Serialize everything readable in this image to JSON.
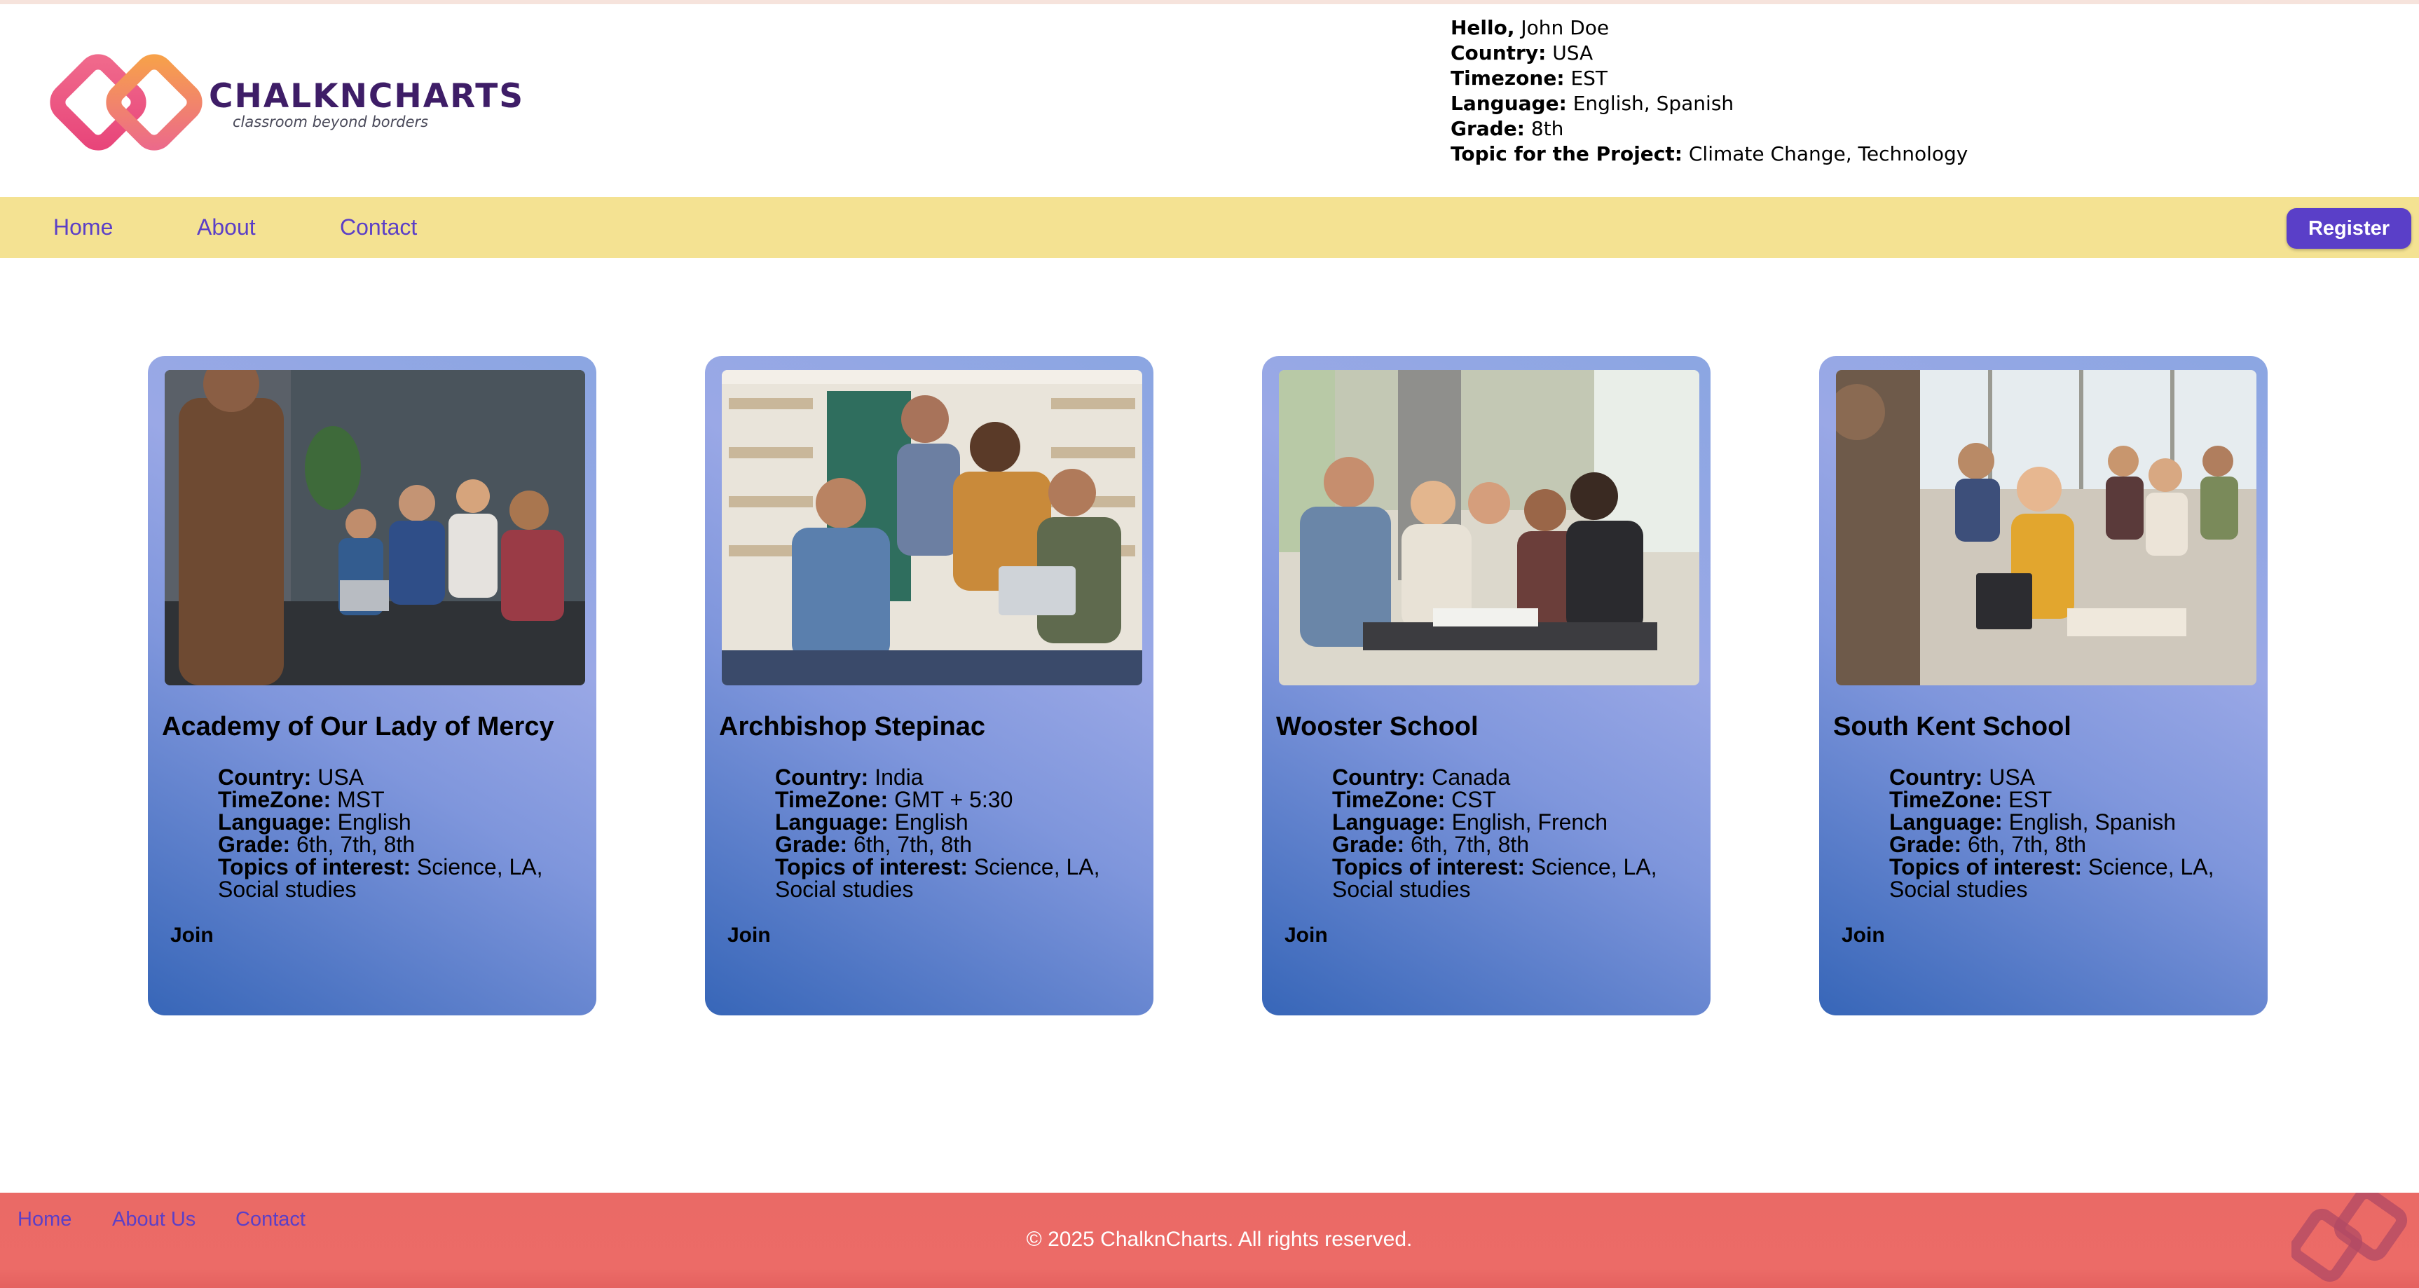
{
  "brand": {
    "name": "CHALKNCHARTS",
    "tagline": "classroom beyond borders"
  },
  "user": {
    "hello_label": "Hello,",
    "name": "John Doe",
    "country_label": "Country:",
    "country": "USA",
    "timezone_label": "Timezone:",
    "timezone": "EST",
    "language_label": "Language:",
    "language": "English, Spanish",
    "grade_label": "Grade:",
    "grade": "8th",
    "topic_label": "Topic for the Project:",
    "topic": "Climate Change, Technology"
  },
  "nav": {
    "items": [
      {
        "label": "Home"
      },
      {
        "label": "About"
      },
      {
        "label": "Contact"
      }
    ],
    "register_label": "Register",
    "accent_color": "#5a3fc8",
    "background_color": "#f4e292"
  },
  "schools": [
    {
      "name": "Academy of Our Lady of Mercy",
      "country": "USA",
      "timezone": "MST",
      "language": "English",
      "grade": "6th, 7th, 8th",
      "topics": "Science, LA, Social studies",
      "join_label": "Join"
    },
    {
      "name": "Archbishop Stepinac",
      "country": "India",
      "timezone": "GMT + 5:30",
      "language": "English",
      "grade": "6th, 7th, 8th",
      "topics": "Science, LA, Social studies",
      "join_label": "Join"
    },
    {
      "name": "Wooster School",
      "country": "Canada",
      "timezone": "CST",
      "language": "English, French",
      "grade": "6th, 7th, 8th",
      "topics": "Science, LA, Social studies",
      "join_label": "Join"
    },
    {
      "name": "South Kent School",
      "country": "USA",
      "timezone": "EST",
      "language": "English, Spanish",
      "grade": "6th, 7th, 8th",
      "topics": "Science, LA, Social studies",
      "join_label": "Join"
    }
  ],
  "card_labels": {
    "country": "Country:",
    "timezone": "TimeZone:",
    "language": "Language:",
    "grade": "Grade:",
    "topics": "Topics of interest:"
  },
  "footer": {
    "links": [
      {
        "label": "Home"
      },
      {
        "label": "About Us"
      },
      {
        "label": "Contact"
      }
    ],
    "copyright": "© 2025 ChalknCharts. All rights reserved.",
    "background_color": "#ec6b67"
  }
}
